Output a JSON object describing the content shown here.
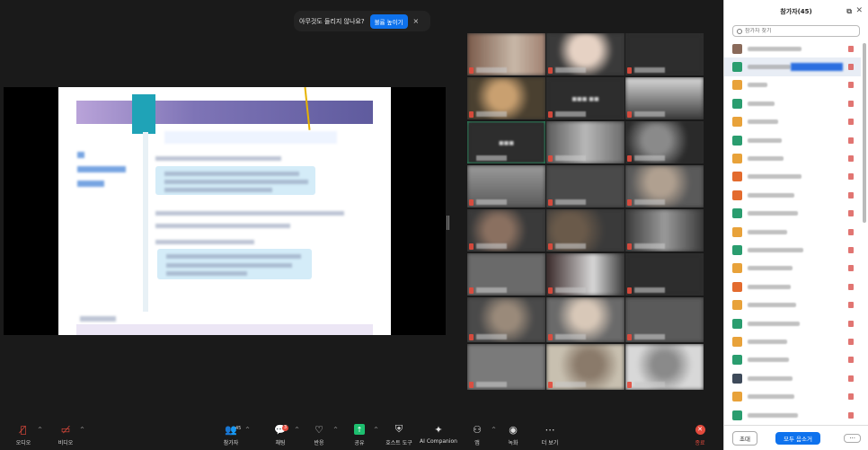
{
  "banner": {
    "message": "아무것도 들리지 않나요?",
    "button": "볼륨 높이기",
    "close": "×"
  },
  "panel": {
    "title": "참가자(45)",
    "popout_icon": "⧉",
    "close_icon": "✕",
    "search_placeholder": "참가자 찾기",
    "invite_label": "초대",
    "mute_all_label": "모두 음소거",
    "more_label": "···",
    "avatar_colors": [
      "#8a6a5a",
      "#2a9d6f",
      "#e8a23a",
      "#2a9d6f",
      "#e8a23a",
      "#2a9d6f",
      "#e8a23a",
      "#e36b2e",
      "#e36b2e",
      "#2a9d6f",
      "#e8a23a",
      "#2a9d6f",
      "#e8a23a",
      "#e36b2e",
      "#e8a23a",
      "#2a9d6f",
      "#e8a23a",
      "#2a9d6f",
      "#3e4a5a",
      "#e8a23a",
      "#2a9d6f",
      "#e8a23a",
      "#2a9d6f"
    ]
  },
  "toolbar": {
    "audio": "오디오",
    "video": "비디오",
    "participants": "참가자",
    "participants_count": "45",
    "chat": "채팅",
    "chat_badge": "3",
    "react": "반응",
    "share": "공유",
    "host_tools": "호스트 도구",
    "ai_companion": "AI Companion",
    "apps": "앱",
    "record": "녹화",
    "more": "더 보기",
    "end": "종료"
  }
}
